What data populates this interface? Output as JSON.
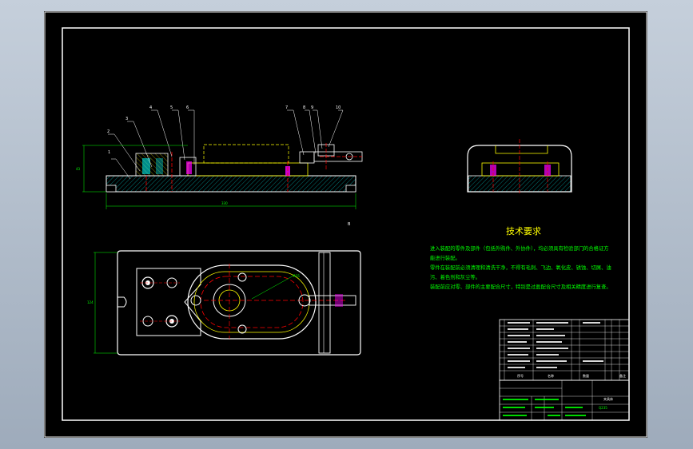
{
  "drawing": {
    "technical_requirements": {
      "title": "技术要求",
      "lines": [
        "进入装配的零件及部件（包括外购件、外协件），均必须具有检验部门的合格证方",
        "能进行装配。",
        "零件在装配前必须清理和清洗干净，不得有毛刺、飞边、氧化皮、锈蚀、切屑、油",
        "污、着色剂和灰尘等。",
        "装配前应对零、部件的主要配合尺寸，特别是过盈配合尺寸及相关精度进行复查。"
      ]
    },
    "balloons": [
      "1",
      "2",
      "3",
      "4",
      "5",
      "6",
      "7",
      "8",
      "9",
      "10"
    ],
    "dims": {
      "front_height": "43",
      "front_length": "330",
      "plan_height": "124",
      "plan_radius": "R35"
    },
    "section_mark": "B",
    "title_block": {
      "col_no": "序号",
      "col_name": "名称",
      "col_qty": "数量",
      "col_remark": "备注",
      "drawing_title": "夹具体",
      "sheet_code": "Q235"
    },
    "colors": {
      "sheet": "#000000",
      "outline": "#ffffff",
      "cyan": "#00ffff",
      "green": "#00ff00",
      "yellow": "#ffff00",
      "red": "#ff0000",
      "magenta": "#ff00ff"
    }
  }
}
